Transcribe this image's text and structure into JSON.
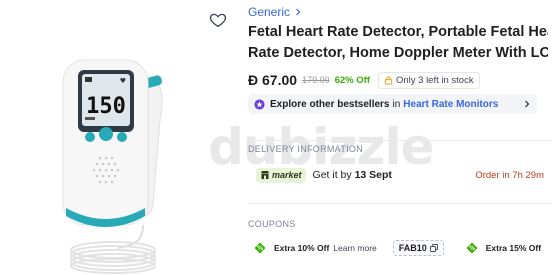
{
  "product": {
    "brand": "Generic",
    "title_line1": "Fetal Heart Rate Detector, Portable Fetal Heart",
    "title_line2": "Rate Detector, Home Doppler Meter With LCD..."
  },
  "pricing": {
    "currency_symbol": "Đ",
    "price": "67.00",
    "old_price": "179.00",
    "discount": "62% Off",
    "stock": "Only 3 left in stock"
  },
  "bestsellers": {
    "bold": "Explore other bestsellers",
    "in": "in",
    "category": "Heart Rate Monitors"
  },
  "delivery": {
    "label": "DELIVERY INFORMATION",
    "badge": "market",
    "text_prefix": "Get it by",
    "date": "13 Sept",
    "order_in": "Order in 7h 29m"
  },
  "coupons": {
    "label": "COUPONS",
    "items": [
      {
        "text": "Extra 10% Off",
        "link": "Learn more",
        "code": "FAB10"
      },
      {
        "text": "Extra 15% Off"
      }
    ]
  },
  "image": {
    "display_reading": "150",
    "watermark": "dubizzle"
  },
  "colors": {
    "accent_blue": "#3866df",
    "discount_green": "#38ae04",
    "order_red": "#c0391f",
    "device_teal": "#27a9b8"
  },
  "icons": {
    "wishlist": "heart-outline-icon",
    "brand_chevron": "chevron-right-icon",
    "stock": "lock-stock-icon",
    "bestseller": "star-badge-icon",
    "coupon": "coupon-tag-icon",
    "copy": "copy-icon"
  }
}
